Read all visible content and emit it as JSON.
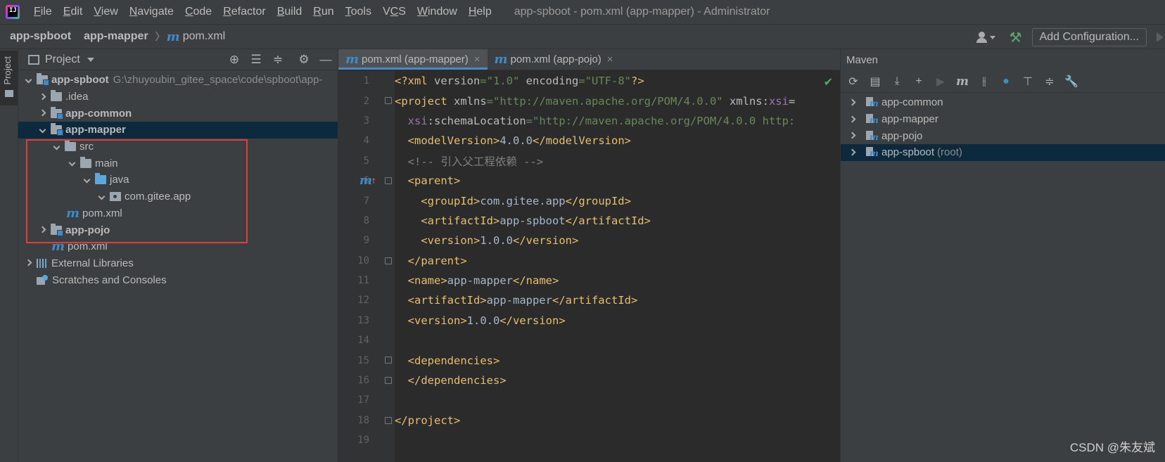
{
  "window": {
    "title": "app-spboot - pom.xml (app-mapper) - Administrator"
  },
  "menu": [
    {
      "label": "File",
      "mnemonic_index": 0
    },
    {
      "label": "Edit",
      "mnemonic_index": 0
    },
    {
      "label": "View",
      "mnemonic_index": 0
    },
    {
      "label": "Navigate",
      "mnemonic_index": 0
    },
    {
      "label": "Code",
      "mnemonic_index": 0
    },
    {
      "label": "Refactor",
      "mnemonic_index": 0
    },
    {
      "label": "Build",
      "mnemonic_index": 0
    },
    {
      "label": "Run",
      "mnemonic_index": 0
    },
    {
      "label": "Tools",
      "mnemonic_index": 0
    },
    {
      "label": "VCS",
      "mnemonic_index": 1
    },
    {
      "label": "Window",
      "mnemonic_index": 0
    },
    {
      "label": "Help",
      "mnemonic_index": 0
    }
  ],
  "breadcrumb": {
    "project": "app-spboot",
    "module": "app-mapper",
    "file": "pom.xml"
  },
  "toolbar": {
    "add_configuration": "Add Configuration..."
  },
  "left_strip": {
    "project_label": "Project"
  },
  "project_panel": {
    "title": "Project",
    "tree": {
      "root_name": "app-spboot",
      "root_path": "G:\\zhuyoubin_gitee_space\\code\\spboot\\app-",
      "idea": ".idea",
      "app_common": "app-common",
      "app_mapper": "app-mapper",
      "src": "src",
      "main": "main",
      "java": "java",
      "package": "com.gitee.app",
      "mapper_pom": "pom.xml",
      "app_pojo": "app-pojo",
      "root_pom": "pom.xml",
      "external_libraries": "External Libraries",
      "scratches": "Scratches and Consoles"
    }
  },
  "editor": {
    "tabs": [
      {
        "label": "pom.xml (app-mapper)",
        "active": true
      },
      {
        "label": "pom.xml (app-pojo)",
        "active": false
      }
    ],
    "lines": [
      {
        "n": "1",
        "parts": [
          [
            "tg",
            "<?xml "
          ],
          [
            "at",
            "version"
          ],
          [
            "av",
            "=\"1.0\""
          ],
          [
            "at",
            " encoding"
          ],
          [
            "av",
            "=\"UTF-8\""
          ],
          [
            "tg",
            "?>"
          ]
        ]
      },
      {
        "n": "2",
        "parts": [
          [
            "tg",
            "<project "
          ],
          [
            "at",
            "xmlns"
          ],
          [
            "av",
            "=\"http://maven.apache.org/POM/4.0.0\""
          ],
          [
            "at",
            " xmlns:"
          ],
          [
            "ns",
            "xsi"
          ],
          [
            "at",
            "="
          ]
        ]
      },
      {
        "n": "3",
        "parts": [
          [
            "tx",
            "  "
          ],
          [
            "ns",
            "xsi"
          ],
          [
            "at",
            ":schemaLocation"
          ],
          [
            "av",
            "=\"http://maven.apache.org/POM/4.0.0 http:"
          ]
        ]
      },
      {
        "n": "4",
        "parts": [
          [
            "tx",
            "  "
          ],
          [
            "tg",
            "<modelVersion>"
          ],
          [
            "tx",
            "4.0.0"
          ],
          [
            "tg",
            "</modelVersion>"
          ]
        ]
      },
      {
        "n": "5",
        "parts": [
          [
            "tx",
            "  "
          ],
          [
            "cm",
            "<!-- 引入父工程依赖 -->"
          ]
        ]
      },
      {
        "n": "6",
        "parts": [
          [
            "tx",
            "  "
          ],
          [
            "tg",
            "<parent>"
          ]
        ]
      },
      {
        "n": "7",
        "parts": [
          [
            "tx",
            "    "
          ],
          [
            "tg",
            "<groupId>"
          ],
          [
            "tx",
            "com.gitee.app"
          ],
          [
            "tg",
            "</groupId>"
          ]
        ]
      },
      {
        "n": "8",
        "parts": [
          [
            "tx",
            "    "
          ],
          [
            "tg",
            "<artifactId>"
          ],
          [
            "tx",
            "app-spboot"
          ],
          [
            "tg",
            "</artifactId>"
          ]
        ]
      },
      {
        "n": "9",
        "parts": [
          [
            "tx",
            "    "
          ],
          [
            "tg",
            "<version>"
          ],
          [
            "tx",
            "1.0.0"
          ],
          [
            "tg",
            "</version>"
          ]
        ]
      },
      {
        "n": "10",
        "parts": [
          [
            "tx",
            "  "
          ],
          [
            "tg",
            "</parent>"
          ]
        ]
      },
      {
        "n": "11",
        "parts": [
          [
            "tx",
            "  "
          ],
          [
            "tg",
            "<name>"
          ],
          [
            "tx",
            "app-mapper"
          ],
          [
            "tg",
            "</name>"
          ]
        ]
      },
      {
        "n": "12",
        "parts": [
          [
            "tx",
            "  "
          ],
          [
            "tg",
            "<artifactId>"
          ],
          [
            "tx",
            "app-mapper"
          ],
          [
            "tg",
            "</artifactId>"
          ]
        ]
      },
      {
        "n": "13",
        "parts": [
          [
            "tx",
            "  "
          ],
          [
            "tg",
            "<version>"
          ],
          [
            "tx",
            "1.0.0"
          ],
          [
            "tg",
            "</version>"
          ]
        ]
      },
      {
        "n": "14",
        "parts": []
      },
      {
        "n": "15",
        "parts": [
          [
            "tx",
            "  "
          ],
          [
            "tg",
            "<dependencies>"
          ]
        ]
      },
      {
        "n": "16",
        "parts": [
          [
            "tx",
            "  "
          ],
          [
            "tg",
            "</dependencies>"
          ]
        ]
      },
      {
        "n": "17",
        "parts": []
      },
      {
        "n": "18",
        "parts": [
          [
            "tg",
            "</project>"
          ]
        ]
      },
      {
        "n": "19",
        "parts": []
      }
    ]
  },
  "maven": {
    "title": "Maven",
    "projects": [
      {
        "name": "app-common",
        "hint": "",
        "selected": false
      },
      {
        "name": "app-mapper",
        "hint": "",
        "selected": false
      },
      {
        "name": "app-pojo",
        "hint": "",
        "selected": false
      },
      {
        "name": "app-spboot",
        "hint": "(root)",
        "selected": true
      }
    ]
  },
  "watermark": "CSDN @朱友斌",
  "colors": {
    "selection": "#0d293e",
    "highlight_box": "#e03c3c",
    "tag": "#e8bf6a",
    "attr_value": "#6a8759",
    "comment": "#808080"
  }
}
